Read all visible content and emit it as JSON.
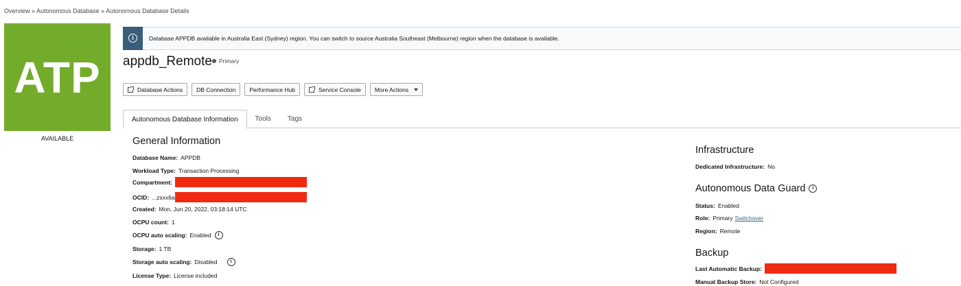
{
  "breadcrumb": {
    "overview": "Overview",
    "sep1": " » ",
    "adb": "Autonomous Database",
    "sep2": " » ",
    "details": "Autonomous Database Details"
  },
  "logo": {
    "text": "ATP",
    "color": "#73ac2a"
  },
  "lifecycle_state": "AVAILABLE",
  "notice": {
    "icon": "info-icon",
    "text": "Database APPDB available in Australia East (Sydney) region. You can switch to source Australia Southeast (Melbourne) region when the database is available."
  },
  "header": {
    "title": "appdb_Remote",
    "role": "Primary"
  },
  "actions": [
    {
      "label": "Database Actions",
      "icon": "external-link-icon"
    },
    {
      "label": "DB Connection"
    },
    {
      "label": "Performance Hub"
    },
    {
      "label": "Service Console",
      "icon": "external-link-icon"
    },
    {
      "label": "More Actions",
      "icon": "chevron-down-icon"
    }
  ],
  "tabs": [
    {
      "label": "Autonomous Database Information",
      "active": true
    },
    {
      "label": "Tools"
    },
    {
      "label": "Tags"
    }
  ],
  "general": {
    "title": "General Information",
    "database_name": {
      "k": "Database Name:",
      "v": "APPDB"
    },
    "workload": {
      "k": "Workload Type:",
      "v": "Transaction Processing"
    },
    "compartment": {
      "k": "Compartment:",
      "v": ""
    },
    "ocid": {
      "k": "OCID:",
      "v": "...zsxx6a"
    },
    "created": {
      "k": "Created:",
      "v": "Mon, Jun 20, 2022, 03:18:14 UTC"
    },
    "ocpu": {
      "k": "OCPU count:",
      "v": "1"
    },
    "ocpu_auto": {
      "k": "OCPU auto scaling:",
      "v": "Enabled"
    },
    "storage": {
      "k": "Storage:",
      "v": "1 TB"
    },
    "storage_auto": {
      "k": "Storage auto scaling:",
      "v": "Disabled"
    },
    "license": {
      "k": "License Type:",
      "v": "License included"
    }
  },
  "infrastructure": {
    "title": "Infrastructure",
    "dedicated": {
      "k": "Dedicated Infrastructure:",
      "v": "No"
    }
  },
  "data_guard": {
    "title": "Autonomous Data Guard",
    "status": {
      "k": "Status:",
      "v": "Enabled"
    },
    "role": {
      "k": "Role:",
      "v": "Primary",
      "link": "Switchover"
    },
    "region": {
      "k": "Region:",
      "v": "Remote"
    }
  },
  "backup": {
    "title": "Backup",
    "last_auto": {
      "k": "Last Automatic Backup:",
      "v": ""
    },
    "manual_store": {
      "k": "Manual Backup Store:",
      "v": "Not Configured"
    }
  },
  "colors": {
    "accent": "#73ac2a",
    "notice_bar": "#3a5d7c",
    "redaction": "#f02a10",
    "link": "#36677d"
  }
}
